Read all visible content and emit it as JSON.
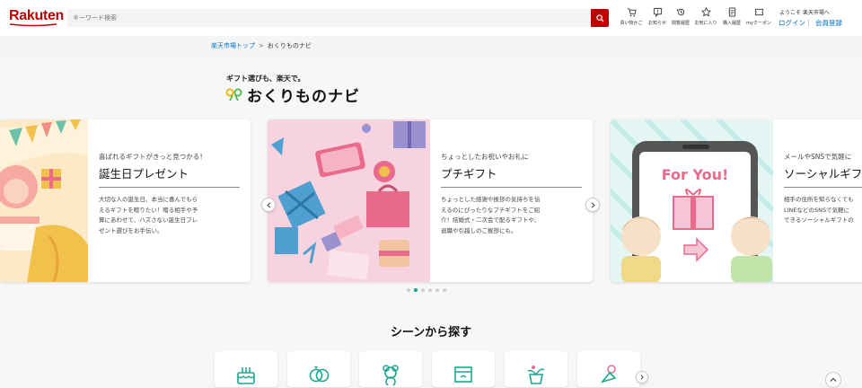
{
  "header": {
    "logo": "Rakuten",
    "search_placeholder": "キーワード検索",
    "nav": [
      {
        "label": "買い物かご",
        "icon": "cart-icon"
      },
      {
        "label": "お知らせ",
        "icon": "notification-icon"
      },
      {
        "label": "閲覧履歴",
        "icon": "history-icon"
      },
      {
        "label": "お気に入り",
        "icon": "star-icon"
      },
      {
        "label": "購入履歴",
        "icon": "receipt-icon"
      },
      {
        "label": "myクーポン",
        "icon": "coupon-icon"
      }
    ],
    "welcome": "ようこそ 楽天市場へ",
    "login": "ログイン",
    "register": "会員登録"
  },
  "breadcrumb": {
    "home": "楽天市場トップ",
    "separator": ">",
    "current": "おくりものナビ"
  },
  "brand": {
    "subtitle": "ギフト選びも、楽天で。",
    "title": "おくりものナビ"
  },
  "carousel": {
    "cards": [
      {
        "kicker": "喜ばれるギフトがきっと見つかる！",
        "title": "誕生日プレゼント",
        "desc": [
          "大切な人の誕生日、本当に喜んでもら",
          "えるギフトを贈りたい！贈る相手や予",
          "算にあわせて、ハズさない誕生日プレ",
          "ゼント選びをお手伝い。"
        ]
      },
      {
        "kicker": "ちょっとしたお祝いやお礼に",
        "title": "プチギフト",
        "desc": [
          "ちょっとした感謝や挨拶の気持ちを伝",
          "えるのにぴったりなプチギフトをご紹",
          "介！結婚式・二次会で配るギフトや、",
          "退職や引越しのご挨拶にも。"
        ]
      },
      {
        "kicker": "メールやSNSで気軽に",
        "title": "ソーシャルギフト",
        "desc": [
          "相手の住所を知らなくても",
          "LINEなどのSNSで気軽に",
          "できるソーシャルギフトの"
        ],
        "image_text": "For You!"
      }
    ],
    "dots": 6,
    "active_dot": 2
  },
  "scenes": {
    "title": "シーンから探す",
    "items": [
      {
        "icon": "cake-icon"
      },
      {
        "icon": "rings-icon"
      },
      {
        "icon": "bear-icon"
      },
      {
        "icon": "envelope-icon"
      },
      {
        "icon": "plant-icon"
      },
      {
        "icon": "bouquet-icon"
      }
    ]
  },
  "colors": {
    "brand": "#bf0000",
    "accent": "#00a29a",
    "link": "#0071c5"
  }
}
